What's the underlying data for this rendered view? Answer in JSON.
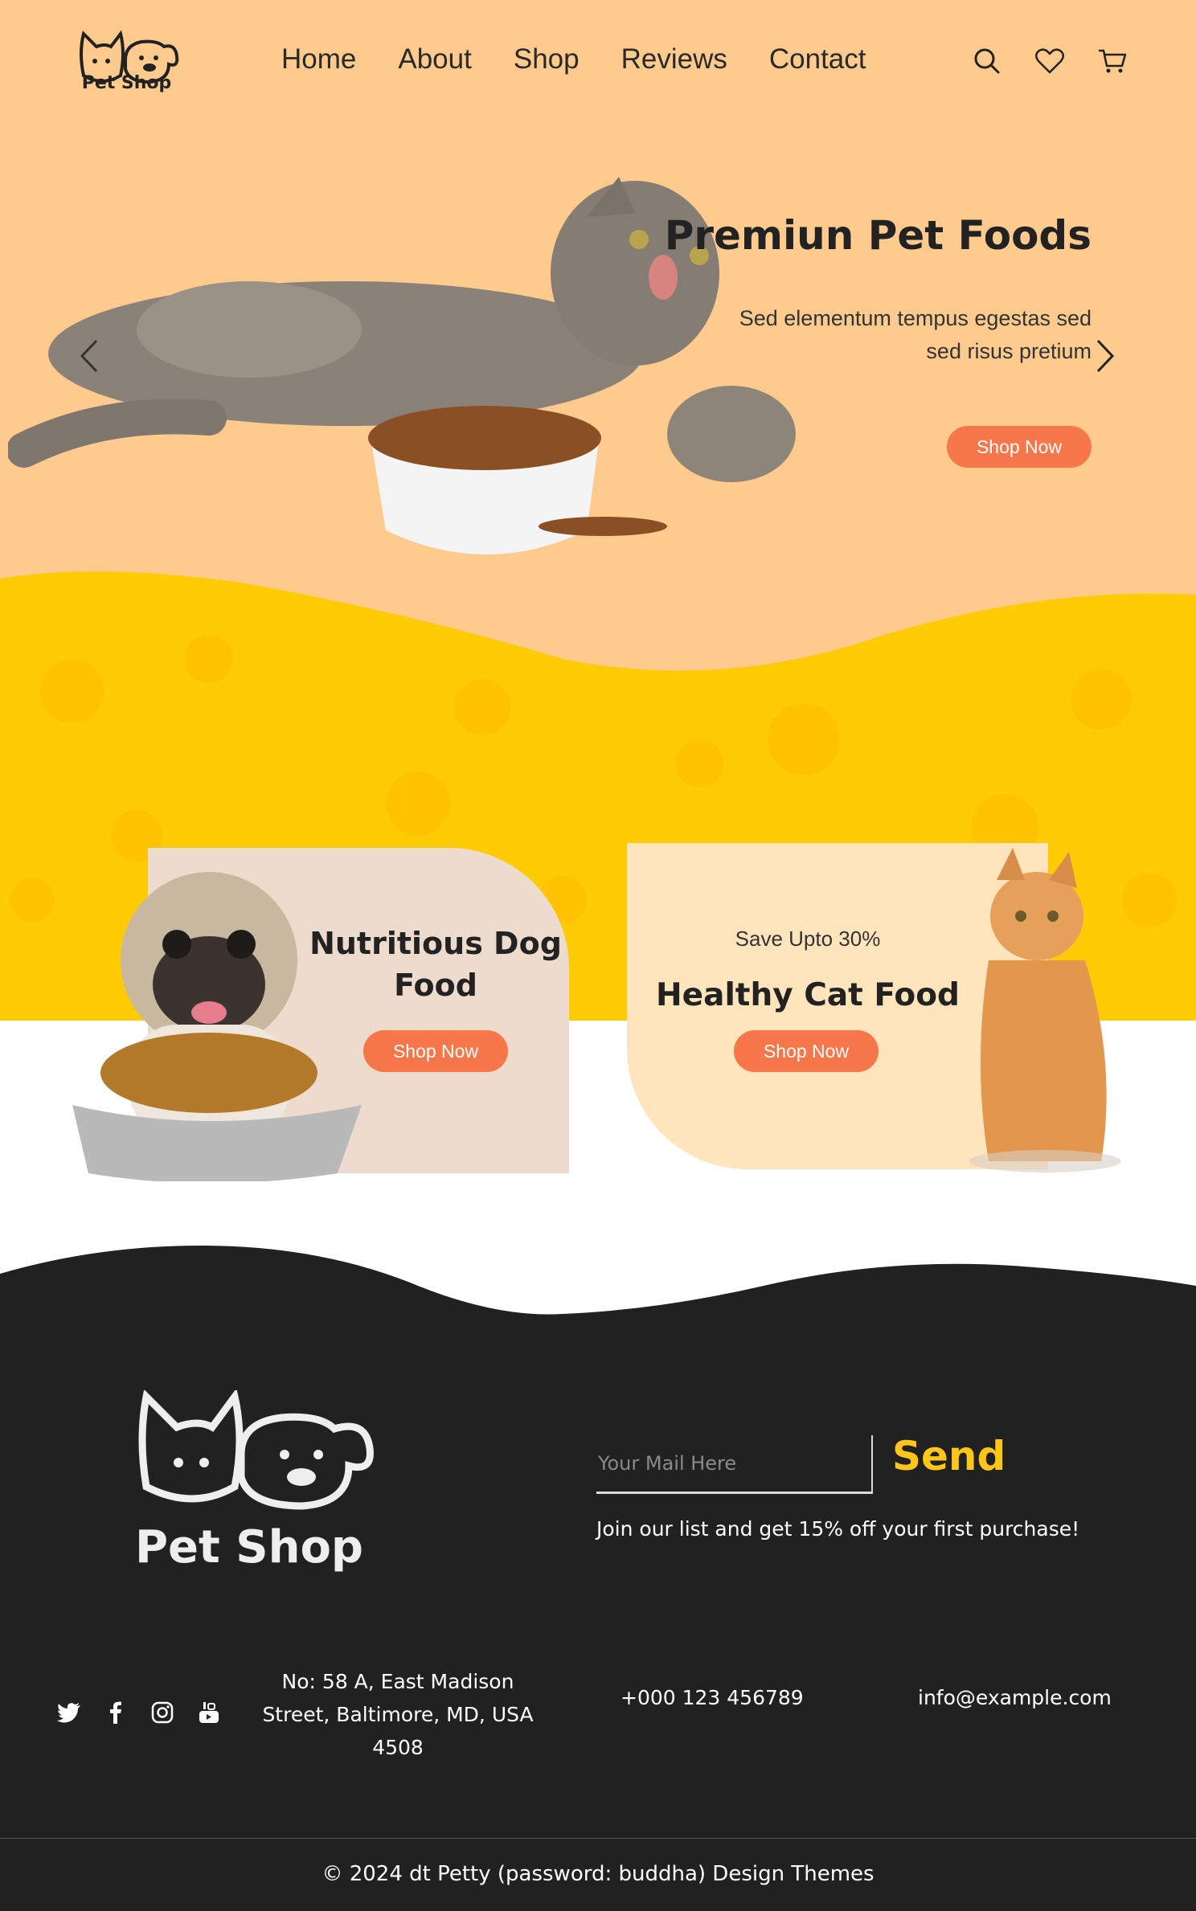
{
  "header": {
    "logo_text": "Pet Shop",
    "nav": [
      "Home",
      "About",
      "Shop",
      "Reviews",
      "Contact"
    ],
    "icons": [
      "search-icon",
      "heart-icon",
      "cart-icon"
    ]
  },
  "hero": {
    "title": "Premiun Pet Foods",
    "description": "Sed elementum tempus egestas sed sed risus pretium",
    "button": "Shop Now",
    "arrows": [
      "chevron-left-icon",
      "chevron-right-icon"
    ]
  },
  "promos": {
    "dog": {
      "title": "Nutritious Dog Food",
      "button": "Shop Now"
    },
    "cat": {
      "tagline": "Save Upto 30%",
      "title": "Healthy Cat Food",
      "button": "Shop Now"
    }
  },
  "footer": {
    "logo_text": "Pet Shop",
    "mail_placeholder": "Your Mail Here",
    "send": "Send",
    "newsletter": "Join our list and get 15% off your first purchase!",
    "social": [
      "twitter-icon",
      "facebook-icon",
      "instagram-icon",
      "youtube-icon"
    ],
    "address": "No: 58 A, East Madison Street, Baltimore, MD, USA 4508",
    "phone": "+000 123 456789",
    "email": "info@example.com",
    "copyright": "© 2024 dt Petty (password: buddha) Design Themes"
  },
  "colors": {
    "hero_bg": "#FECA8E",
    "band_yellow": "#FFCB05",
    "accent_button": "#F7764A",
    "send_yellow": "#FFC61A",
    "footer_bg": "#222122"
  }
}
